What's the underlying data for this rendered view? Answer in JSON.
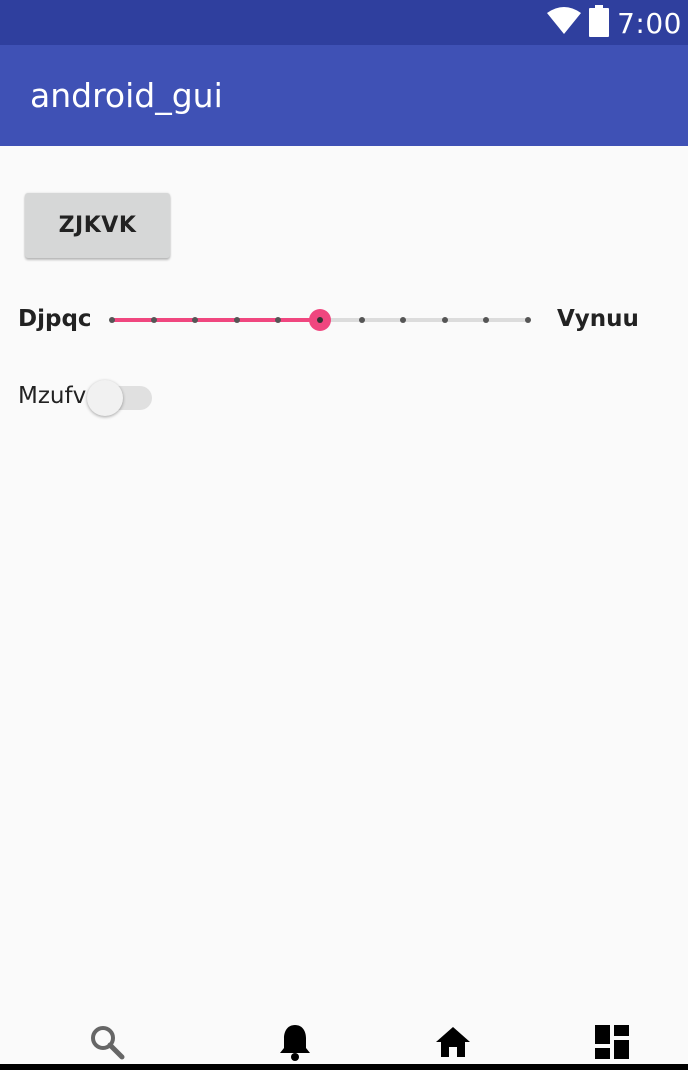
{
  "status_bar": {
    "time": "7:00",
    "icons": [
      "wifi-icon",
      "battery-icon"
    ],
    "background": "#2f3f9e"
  },
  "app_bar": {
    "title": "android_gui",
    "background": "#3f51b5"
  },
  "main": {
    "button": {
      "label": "ZJKVK"
    },
    "seekbar": {
      "left_label": "Djpqc",
      "right_label": "Vynuu",
      "max": 10,
      "value": 5,
      "accent": "#f0467f"
    },
    "switch": {
      "label": "Mzufv",
      "checked": false
    }
  },
  "bottom_nav": {
    "items": [
      {
        "icon": "search-icon"
      },
      {
        "icon": "bell-icon"
      },
      {
        "icon": "home-icon"
      },
      {
        "icon": "dashboard-icon"
      }
    ]
  }
}
